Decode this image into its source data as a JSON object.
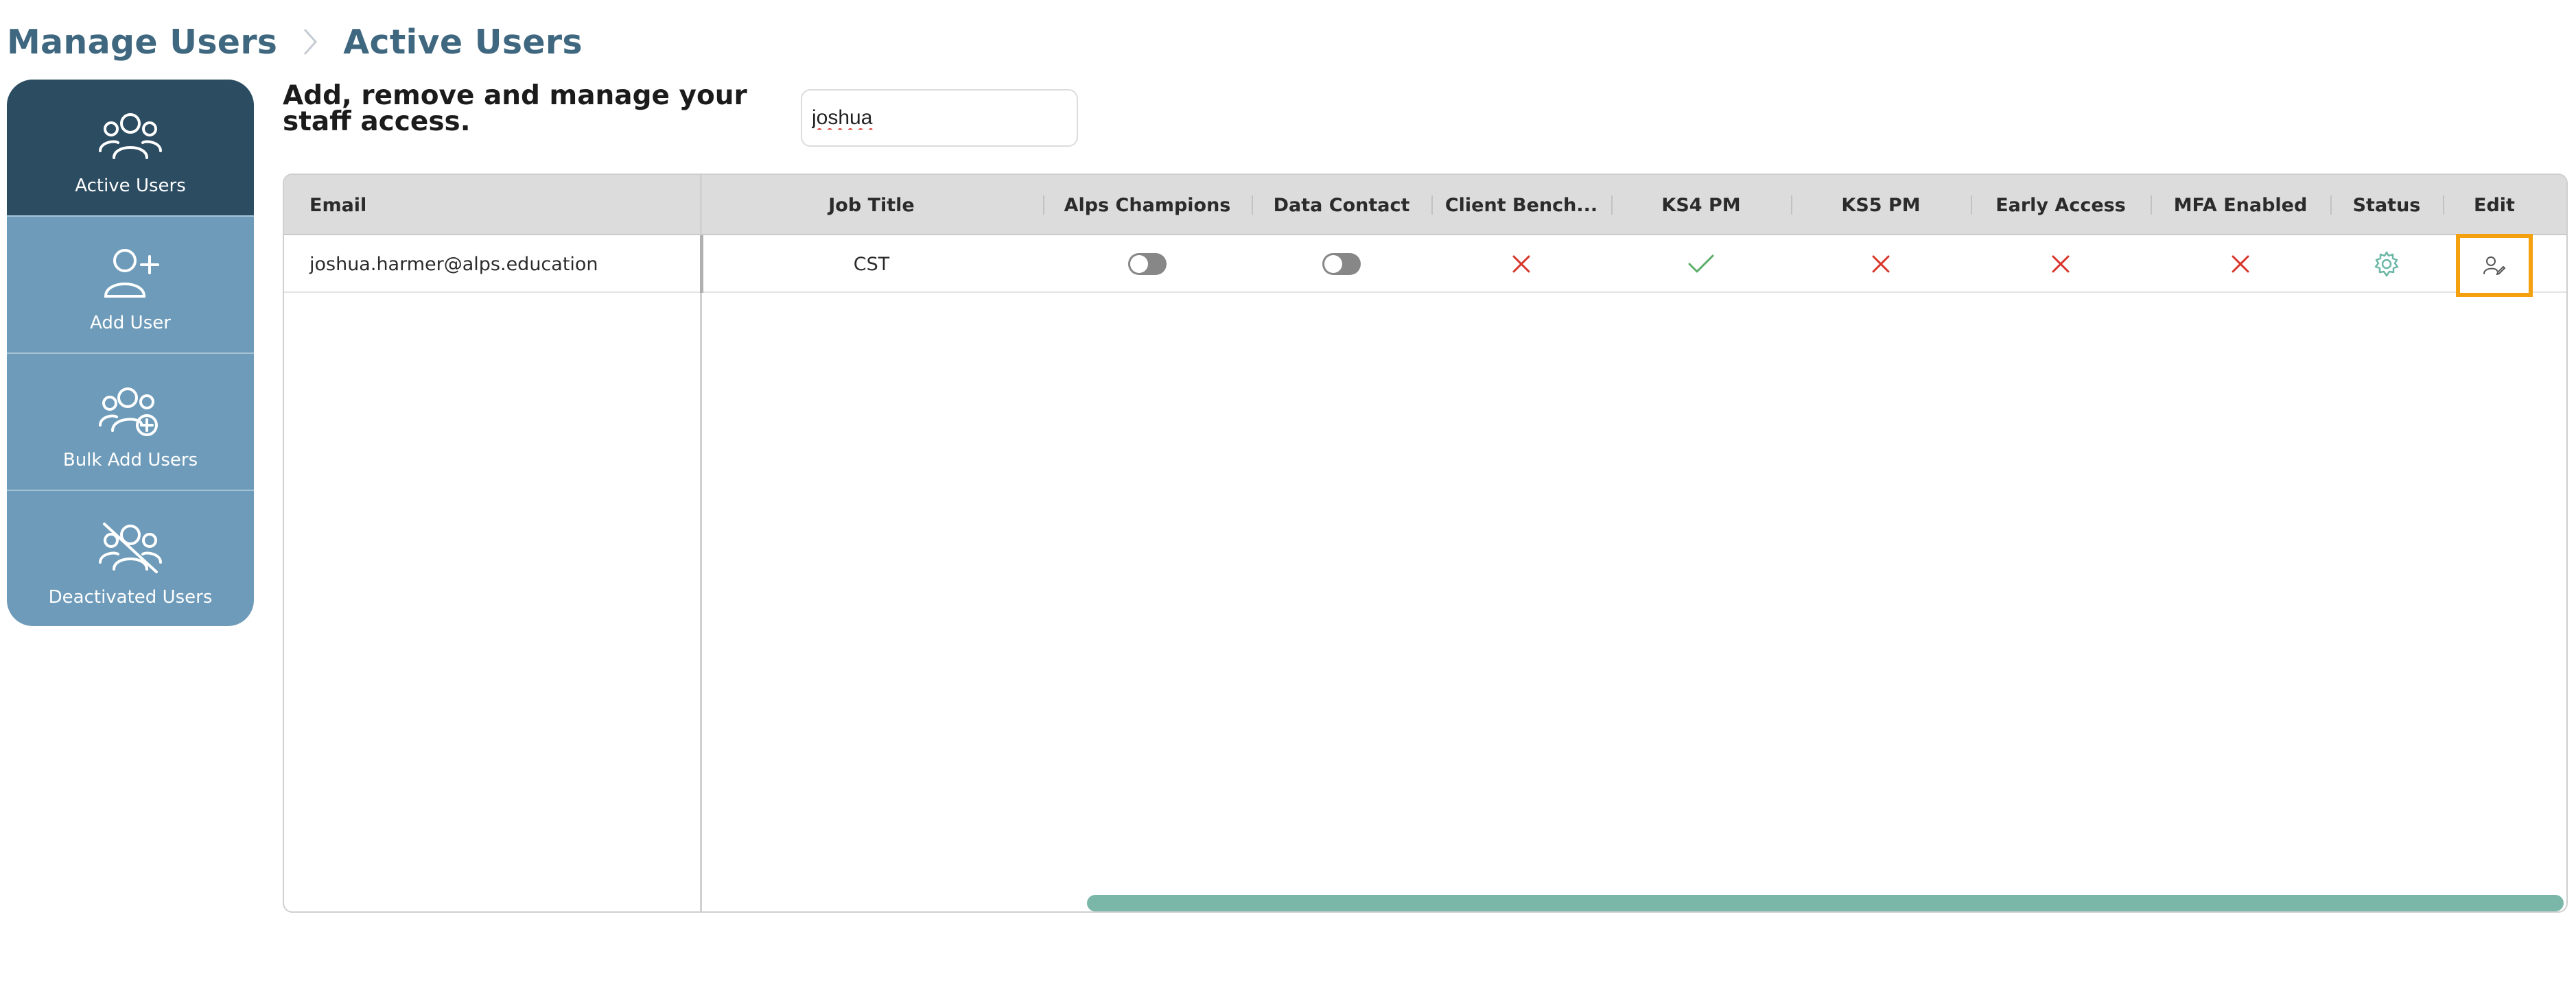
{
  "breadcrumb": {
    "parent": "Manage Users",
    "current": "Active Users"
  },
  "sidebar": {
    "items": [
      {
        "label": "Active Users",
        "icon": "users-icon",
        "active": true
      },
      {
        "label": "Add User",
        "icon": "user-plus-icon",
        "active": false
      },
      {
        "label": "Bulk Add Users",
        "icon": "users-plus-icon",
        "active": false
      },
      {
        "label": "Deactivated Users",
        "icon": "users-slash-icon",
        "active": false
      }
    ]
  },
  "heading": "Add, remove and manage your staff access.",
  "search": {
    "value": "joshua"
  },
  "table": {
    "columns": [
      "Email",
      "Job Title",
      "Alps Champions",
      "Data Contact",
      "Client Bench...",
      "KS4 PM",
      "KS5 PM",
      "Early Access",
      "MFA Enabled",
      "Status",
      "Edit"
    ],
    "rows": [
      {
        "email": "joshua.harmer@alps.education",
        "job_title": "CST",
        "alps_champions": false,
        "data_contact": false,
        "client_bench": false,
        "ks4_pm": true,
        "ks5_pm": false,
        "early_access": false,
        "mfa_enabled": false,
        "status_icon": "gear-icon",
        "edit_icon": "user-edit-icon"
      }
    ]
  },
  "colors": {
    "brand": "#3f6880",
    "sidebar": "#6d9bb9",
    "sidebar_active": "#2c4c62",
    "check": "#5cae6b",
    "cross": "#d9362b",
    "status_gear": "#6bb7a6",
    "highlight": "#f5a00f",
    "scrollbar": "#7bb7a9"
  }
}
